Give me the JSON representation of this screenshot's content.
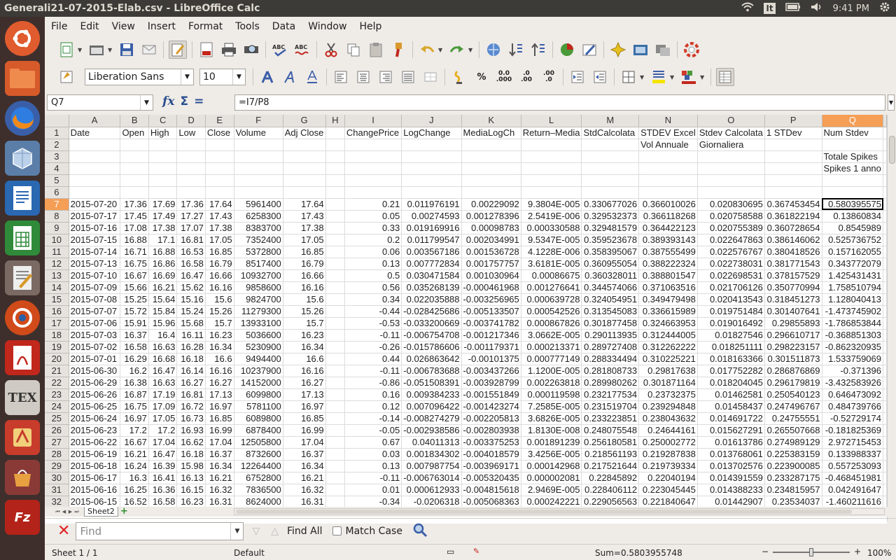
{
  "window": {
    "title": "Generali21-07-2015-Elab.csv - LibreOffice Calc"
  },
  "system": {
    "keyboard": "It",
    "clock": "9:41 PM"
  },
  "menu": [
    "File",
    "Edit",
    "View",
    "Insert",
    "Format",
    "Tools",
    "Data",
    "Window",
    "Help"
  ],
  "toolbar": {
    "font_name": "Liberation Sans",
    "font_size": "10"
  },
  "formula_bar": {
    "cell_ref": "Q7",
    "formula": "=I7/P8"
  },
  "grid": {
    "columns": [
      "A",
      "B",
      "C",
      "D",
      "E",
      "F",
      "G",
      "H",
      "I",
      "J",
      "K",
      "L",
      "M",
      "N",
      "O",
      "P",
      "Q"
    ],
    "selected_column": "Q",
    "rows": [
      {
        "n": "1",
        "c": [
          "Date",
          "Open",
          "High",
          "Low",
          "Close",
          "Volume",
          "Adj Close",
          "",
          "ChangePrice",
          "LogChange",
          "MediaLogCh",
          "Return–Media",
          "StdCalcolata",
          "STDEV Excel",
          "Stdev Calcolata",
          "1 STDev",
          "Num Stdev"
        ]
      },
      {
        "n": "2",
        "c": [
          "",
          "",
          "",
          "",
          "",
          "",
          "",
          "",
          "",
          "",
          "",
          "",
          "",
          "Vol Annuale",
          "Giornaliera",
          "",
          ""
        ]
      },
      {
        "n": "3",
        "c": [
          "",
          "",
          "",
          "",
          "",
          "",
          "",
          "",
          "",
          "",
          "",
          "",
          "",
          "",
          "",
          "",
          "Totale Spikes"
        ]
      },
      {
        "n": "4",
        "c": [
          "",
          "",
          "",
          "",
          "",
          "",
          "",
          "",
          "",
          "",
          "",
          "",
          "",
          "",
          "",
          "",
          "Spikes 1 anno"
        ]
      },
      {
        "n": "5",
        "c": [
          "",
          "",
          "",
          "",
          "",
          "",
          "",
          "",
          "",
          "",
          "",
          "",
          "",
          "",
          "",
          "",
          ""
        ]
      },
      {
        "n": "6",
        "c": [
          "",
          "",
          "",
          "",
          "",
          "",
          "",
          "",
          "",
          "",
          "",
          "",
          "",
          "",
          "",
          "",
          ""
        ]
      },
      {
        "n": "7",
        "c": [
          "2015-07-20",
          "17.36",
          "17.69",
          "17.36",
          "17.64",
          "5961400",
          "17.64",
          "",
          "0.21",
          "0.011976191",
          "0.00229092",
          "9.3804E-005",
          "0.330677026",
          "0.366010026",
          "0.020830695",
          "0.367453454",
          "0.580395575"
        ]
      },
      {
        "n": "8",
        "c": [
          "2015-07-17",
          "17.45",
          "17.49",
          "17.27",
          "17.43",
          "6258300",
          "17.43",
          "",
          "0.05",
          "0.00274593",
          "0.001278396",
          "2.5419E-006",
          "0.329532373",
          "0.366118268",
          "0.020758588",
          "0.361822194",
          "0.13860834"
        ]
      },
      {
        "n": "9",
        "c": [
          "2015-07-16",
          "17.08",
          "17.38",
          "17.07",
          "17.38",
          "8383700",
          "17.38",
          "",
          "0.33",
          "0.019169916",
          "0.00098783",
          "0.000330588",
          "0.329481579",
          "0.364422123",
          "0.020755389",
          "0.360728654",
          "0.8545989"
        ]
      },
      {
        "n": "10",
        "c": [
          "2015-07-15",
          "16.88",
          "17.1",
          "16.81",
          "17.05",
          "7352400",
          "17.05",
          "",
          "0.2",
          "0.011799547",
          "0.002034991",
          "9.5347E-005",
          "0.359523678",
          "0.389393143",
          "0.022647863",
          "0.386146062",
          "0.525736752"
        ]
      },
      {
        "n": "11",
        "c": [
          "2015-07-14",
          "16.71",
          "16.88",
          "16.53",
          "16.85",
          "5372800",
          "16.85",
          "",
          "0.06",
          "0.003567186",
          "0.001536728",
          "4.1228E-006",
          "0.358395067",
          "0.387555499",
          "0.022576767",
          "0.380418526",
          "0.157162055"
        ]
      },
      {
        "n": "12",
        "c": [
          "2015-07-13",
          "16.75",
          "16.86",
          "16.58",
          "16.79",
          "8517400",
          "16.79",
          "",
          "0.13",
          "0.007772834",
          "0.001757757",
          "3.6181E-005",
          "0.360955054",
          "0.388222324",
          "0.022738031",
          "0.381771543",
          "0.343772079"
        ]
      },
      {
        "n": "13",
        "c": [
          "2015-07-10",
          "16.67",
          "16.69",
          "16.47",
          "16.66",
          "10932700",
          "16.66",
          "",
          "0.5",
          "0.030471584",
          "0.001030964",
          "0.00086675",
          "0.360328011",
          "0.388801547",
          "0.022698531",
          "0.378157529",
          "1.425431431"
        ]
      },
      {
        "n": "14",
        "c": [
          "2015-07-09",
          "15.66",
          "16.21",
          "15.62",
          "16.16",
          "9858600",
          "16.16",
          "",
          "0.56",
          "0.035268139",
          "-0.000461968",
          "0.001276641",
          "0.344574066",
          "0.371063516",
          "0.021706126",
          "0.350770994",
          "1.758510794"
        ]
      },
      {
        "n": "15",
        "c": [
          "2015-07-08",
          "15.25",
          "15.64",
          "15.16",
          "15.6",
          "9824700",
          "15.6",
          "",
          "0.34",
          "0.022035888",
          "-0.003256965",
          "0.000639728",
          "0.324054951",
          "0.349479498",
          "0.020413543",
          "0.318451273",
          "1.128040413"
        ]
      },
      {
        "n": "16",
        "c": [
          "2015-07-07",
          "15.72",
          "15.84",
          "15.24",
          "15.26",
          "11279300",
          "15.26",
          "",
          "-0.44",
          "-0.028425686",
          "-0.005133507",
          "0.000542526",
          "0.313545083",
          "0.336615989",
          "0.019751484",
          "0.301407641",
          "-1.473745902"
        ]
      },
      {
        "n": "17",
        "c": [
          "2015-07-06",
          "15.91",
          "15.96",
          "15.68",
          "15.7",
          "13933100",
          "15.7",
          "",
          "-0.53",
          "-0.033200669",
          "-0.003741782",
          "0.000867826",
          "0.301877458",
          "0.324663953",
          "0.019016492",
          "0.29855893",
          "-1.786853844"
        ]
      },
      {
        "n": "18",
        "c": [
          "2015-07-03",
          "16.37",
          "16.4",
          "16.11",
          "16.23",
          "5036600",
          "16.23",
          "",
          "-0.11",
          "-0.006754708",
          "-0.001217346",
          "3.0662E-005",
          "0.290113935",
          "0.312444005",
          "0.01827546",
          "0.296610717",
          "-0.368851303"
        ]
      },
      {
        "n": "19",
        "c": [
          "2015-07-02",
          "16.58",
          "16.63",
          "16.28",
          "16.34",
          "5230900",
          "16.34",
          "",
          "-0.26",
          "-0.015786606",
          "-0.001179371",
          "0.000213371",
          "0.289727408",
          "0.312262222",
          "0.018251111",
          "0.298223157",
          "-0.862320935"
        ]
      },
      {
        "n": "20",
        "c": [
          "2015-07-01",
          "16.29",
          "16.68",
          "16.18",
          "16.6",
          "9494400",
          "16.6",
          "",
          "0.44",
          "0.026863642",
          "-0.00101375",
          "0.000777149",
          "0.288334494",
          "0.310225221",
          "0.018163366",
          "0.301511873",
          "1.533759069"
        ]
      },
      {
        "n": "21",
        "c": [
          "2015-06-30",
          "16.2",
          "16.47",
          "16.14",
          "16.16",
          "10237900",
          "16.16",
          "",
          "-0.11",
          "-0.006783688",
          "-0.003437266",
          "1.1200E-005",
          "0.281808733",
          "0.29817638",
          "0.017752282",
          "0.286876869",
          "-0.371396"
        ]
      },
      {
        "n": "22",
        "c": [
          "2015-06-29",
          "16.38",
          "16.63",
          "16.27",
          "16.27",
          "14152000",
          "16.27",
          "",
          "-0.86",
          "-0.051508391",
          "-0.003928799",
          "0.002263818",
          "0.289980262",
          "0.301871164",
          "0.018204045",
          "0.296179819",
          "-3.432583926"
        ]
      },
      {
        "n": "23",
        "c": [
          "2015-06-26",
          "16.87",
          "17.19",
          "16.81",
          "17.13",
          "6099800",
          "17.13",
          "",
          "0.16",
          "0.009384233",
          "-0.001551849",
          "0.000119598",
          "0.232177534",
          "0.23732375",
          "0.01462581",
          "0.250540123",
          "0.646473092"
        ]
      },
      {
        "n": "24",
        "c": [
          "2015-06-25",
          "16.75",
          "17.09",
          "16.72",
          "16.97",
          "5781100",
          "16.97",
          "",
          "0.12",
          "0.007096422",
          "-0.001423274",
          "7.2585E-005",
          "0.231519704",
          "0.239294848",
          "0.01458437",
          "0.247496767",
          "0.484739766"
        ]
      },
      {
        "n": "25",
        "c": [
          "2015-06-24",
          "16.97",
          "17.05",
          "16.73",
          "16.85",
          "6089800",
          "16.85",
          "",
          "-0.14",
          "-0.008274279",
          "-0.002205813",
          "3.6826E-005",
          "0.233223851",
          "0.238043632",
          "0.014691722",
          "0.24755551",
          "-0.52729174"
        ]
      },
      {
        "n": "26",
        "c": [
          "2015-06-23",
          "17.2",
          "17.2",
          "16.93",
          "16.99",
          "6878400",
          "16.99",
          "",
          "-0.05",
          "-0.002938586",
          "-0.002803938",
          "1.8130E-008",
          "0.248075548",
          "0.24644161",
          "0.015627291",
          "0.265507668",
          "-0.181825369"
        ]
      },
      {
        "n": "27",
        "c": [
          "2015-06-22",
          "16.67",
          "17.04",
          "16.62",
          "17.04",
          "12505800",
          "17.04",
          "",
          "0.67",
          "0.04011313",
          "-0.003375253",
          "0.001891239",
          "0.256180581",
          "0.250002772",
          "0.01613786",
          "0.274989129",
          "2.972715453"
        ]
      },
      {
        "n": "28",
        "c": [
          "2015-06-19",
          "16.21",
          "16.47",
          "16.18",
          "16.37",
          "8732600",
          "16.37",
          "",
          "0.03",
          "0.001834302",
          "-0.004018579",
          "3.4256E-005",
          "0.218561193",
          "0.219287838",
          "0.013768061",
          "0.225383159",
          "0.133988337"
        ]
      },
      {
        "n": "29",
        "c": [
          "2015-06-18",
          "16.24",
          "16.39",
          "15.98",
          "16.34",
          "12264400",
          "16.34",
          "",
          "0.13",
          "0.007987754",
          "-0.003969171",
          "0.000142968",
          "0.217521644",
          "0.219739334",
          "0.013702576",
          "0.223900085",
          "0.557253093"
        ]
      },
      {
        "n": "30",
        "c": [
          "2015-06-17",
          "16.3",
          "16.41",
          "16.13",
          "16.21",
          "6752800",
          "16.21",
          "",
          "-0.11",
          "-0.006763014",
          "-0.005320435",
          "0.000002081",
          "0.22845892",
          "0.22040194",
          "0.014391559",
          "0.233287175",
          "-0.468451981"
        ]
      },
      {
        "n": "31",
        "c": [
          "2015-06-16",
          "16.25",
          "16.36",
          "16.15",
          "16.32",
          "7836500",
          "16.32",
          "",
          "0.01",
          "0.000612933",
          "-0.004815618",
          "2.9469E-005",
          "0.228406112",
          "0.223045445",
          "0.014388233",
          "0.234815957",
          "0.042491647"
        ]
      },
      {
        "n": "32",
        "c": [
          "2015-06-15",
          "16.52",
          "16.58",
          "16.23",
          "16.31",
          "8624000",
          "16.31",
          "",
          "-0.34",
          "-0.0206318",
          "-0.005068363",
          "0.000242221",
          "0.229056563",
          "0.221840647",
          "0.01442907",
          "0.23534037",
          "-1.460211616"
        ]
      }
    ]
  },
  "sheet_tab": "Sheet2",
  "find": {
    "placeholder": "Find",
    "find_all": "Find All",
    "match_case": "Match Case"
  },
  "status": {
    "sheet": "Sheet 1 / 1",
    "style": "Default",
    "sum": "Sum=0.5803955748",
    "zoom": "100%"
  }
}
